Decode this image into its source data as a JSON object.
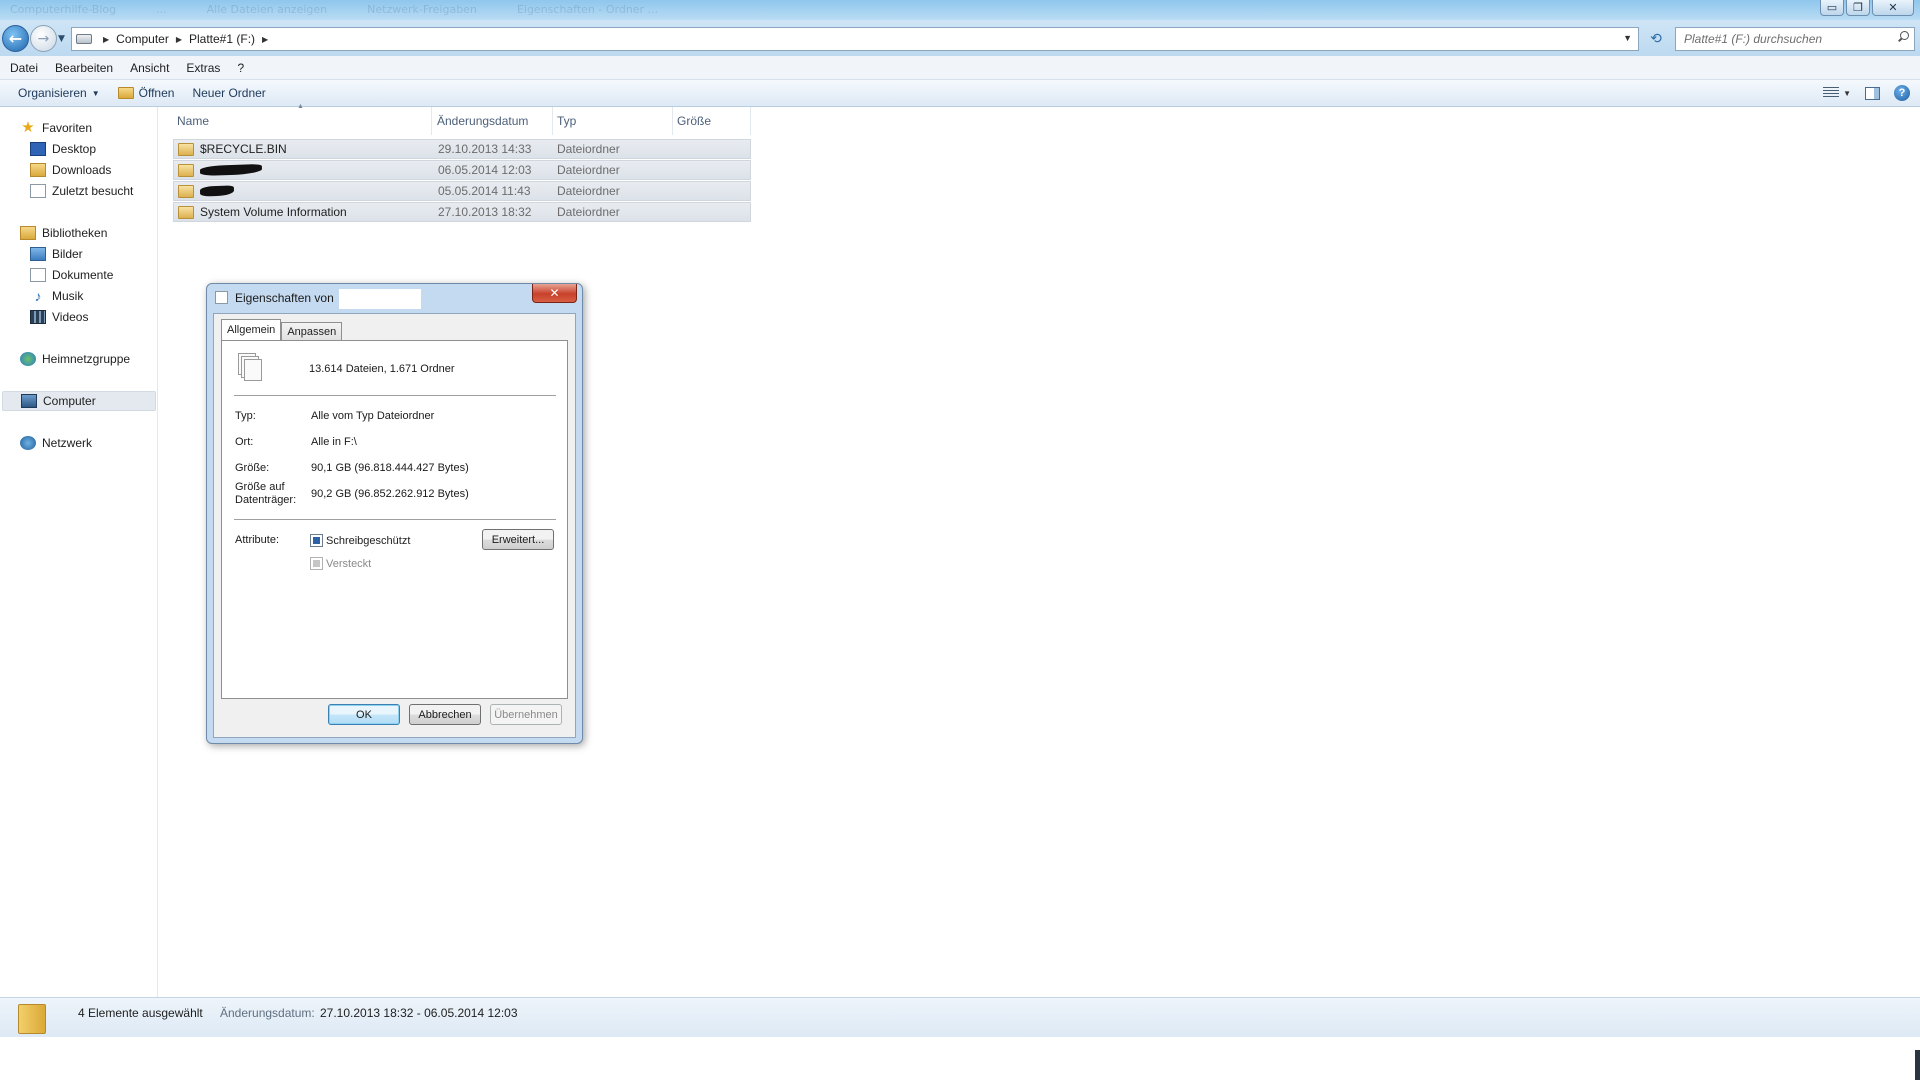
{
  "window": {
    "faded_tabs": [
      "Computerhilfe-Blog",
      "...",
      "Alle Dateien anzeigen",
      "Netzwerk-Freigaben",
      "Eigenschaften - Ordner ..."
    ],
    "minimize": "▭",
    "maximize": "❐",
    "close": "✕"
  },
  "address": {
    "crumbs": [
      "Computer",
      "Platte#1 (F:)"
    ],
    "search_placeholder": "Platte#1 (F:) durchsuchen"
  },
  "menu": [
    "Datei",
    "Bearbeiten",
    "Ansicht",
    "Extras",
    "?"
  ],
  "commands": {
    "organize": "Organisieren",
    "open": "Öffnen",
    "new_folder": "Neuer Ordner"
  },
  "sidebar": {
    "favorites": "Favoriten",
    "favorites_items": [
      "Desktop",
      "Downloads",
      "Zuletzt besucht"
    ],
    "libraries": "Bibliotheken",
    "libraries_items": [
      "Bilder",
      "Dokumente",
      "Musik",
      "Videos"
    ],
    "homegroup": "Heimnetzgruppe",
    "computer": "Computer",
    "network": "Netzwerk"
  },
  "columns": {
    "name": "Name",
    "modified": "Änderungsdatum",
    "type": "Typ",
    "size": "Größe"
  },
  "files": [
    {
      "name": "$RECYCLE.BIN",
      "modified": "29.10.2013 14:33",
      "type": "Dateiordner"
    },
    {
      "name": "",
      "modified": "06.05.2014 12:03",
      "type": "Dateiordner",
      "redacted": true
    },
    {
      "name": "",
      "modified": "05.05.2014 11:43",
      "type": "Dateiordner",
      "redacted": true
    },
    {
      "name": "System Volume Information",
      "modified": "27.10.2013 18:32",
      "type": "Dateiordner"
    }
  ],
  "details": {
    "count": "4 Elemente ausgewählt",
    "modified_label": "Änderungsdatum:",
    "modified_value": "27.10.2013 18:32 - 06.05.2014 12:03"
  },
  "dialog": {
    "title": "Eigenschaften von",
    "close": "✕",
    "tabs": [
      "Allgemein",
      "Anpassen"
    ],
    "summary": "13.614 Dateien, 1.671 Ordner",
    "type_label": "Typ:",
    "type_value": "Alle vom Typ Dateiordner",
    "location_label": "Ort:",
    "location_value": "Alle in F:\\",
    "size_label": "Größe:",
    "size_value": "90,1 GB (96.818.444.427 Bytes)",
    "disk_size_label_1": "Größe auf",
    "disk_size_label_2": "Datenträger:",
    "disk_size_value": "90,2 GB (96.852.262.912 Bytes)",
    "attributes_label": "Attribute:",
    "readonly": "Schreibgeschützt",
    "hidden": "Versteckt",
    "advanced": "Erweitert...",
    "ok": "OK",
    "cancel": "Abbrechen",
    "apply": "Übernehmen"
  }
}
